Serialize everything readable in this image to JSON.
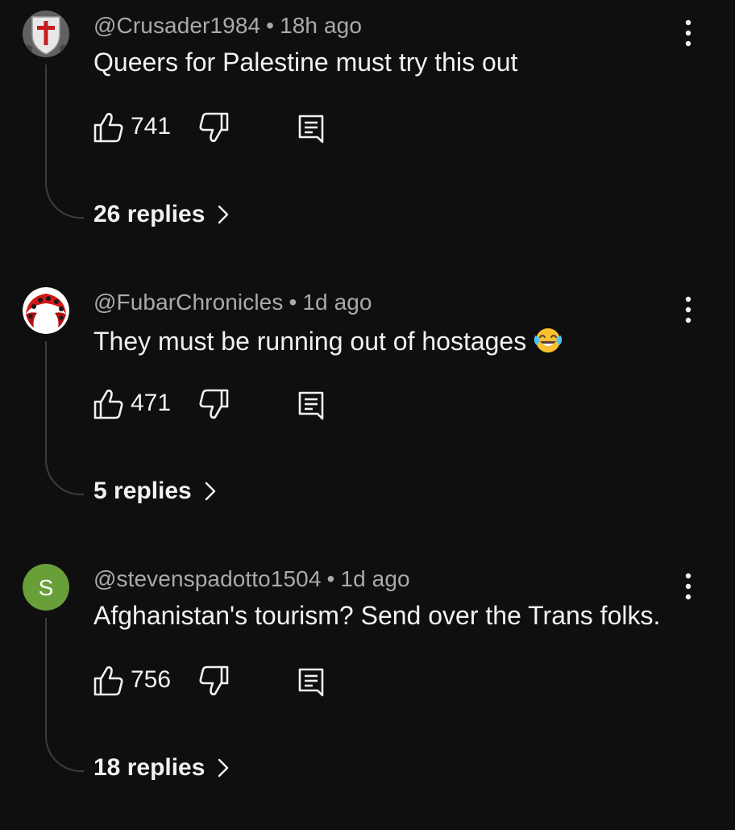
{
  "comments": [
    {
      "handle": "@Crusader1984",
      "time": "18h ago",
      "text": "Queers for Palestine must try this out",
      "emoji": "",
      "likes": "741",
      "replies": "26 replies",
      "avatar": "crusader-shield-avatar"
    },
    {
      "handle": "@FubarChronicles",
      "time": "1d ago",
      "text": "They must be running out of hostages",
      "emoji": "face-with-tears-of-joy",
      "likes": "471",
      "replies": "5 replies",
      "avatar": "red-pattern-avatar"
    },
    {
      "handle": "@stevenspadotto1504",
      "time": "1d ago",
      "text": "Afghanistan's tourism? Send over the Trans folks.",
      "emoji": "",
      "likes": "756",
      "replies": "18 replies",
      "avatar": "letter-avatar",
      "avatar_letter": "S",
      "avatar_color": "#689f38"
    }
  ],
  "separator": "•",
  "colors": {
    "background": "#0f0f0f",
    "text_primary": "#f1f1f1",
    "text_secondary": "#aaaaaa",
    "thread_line": "#3d3d3d"
  }
}
